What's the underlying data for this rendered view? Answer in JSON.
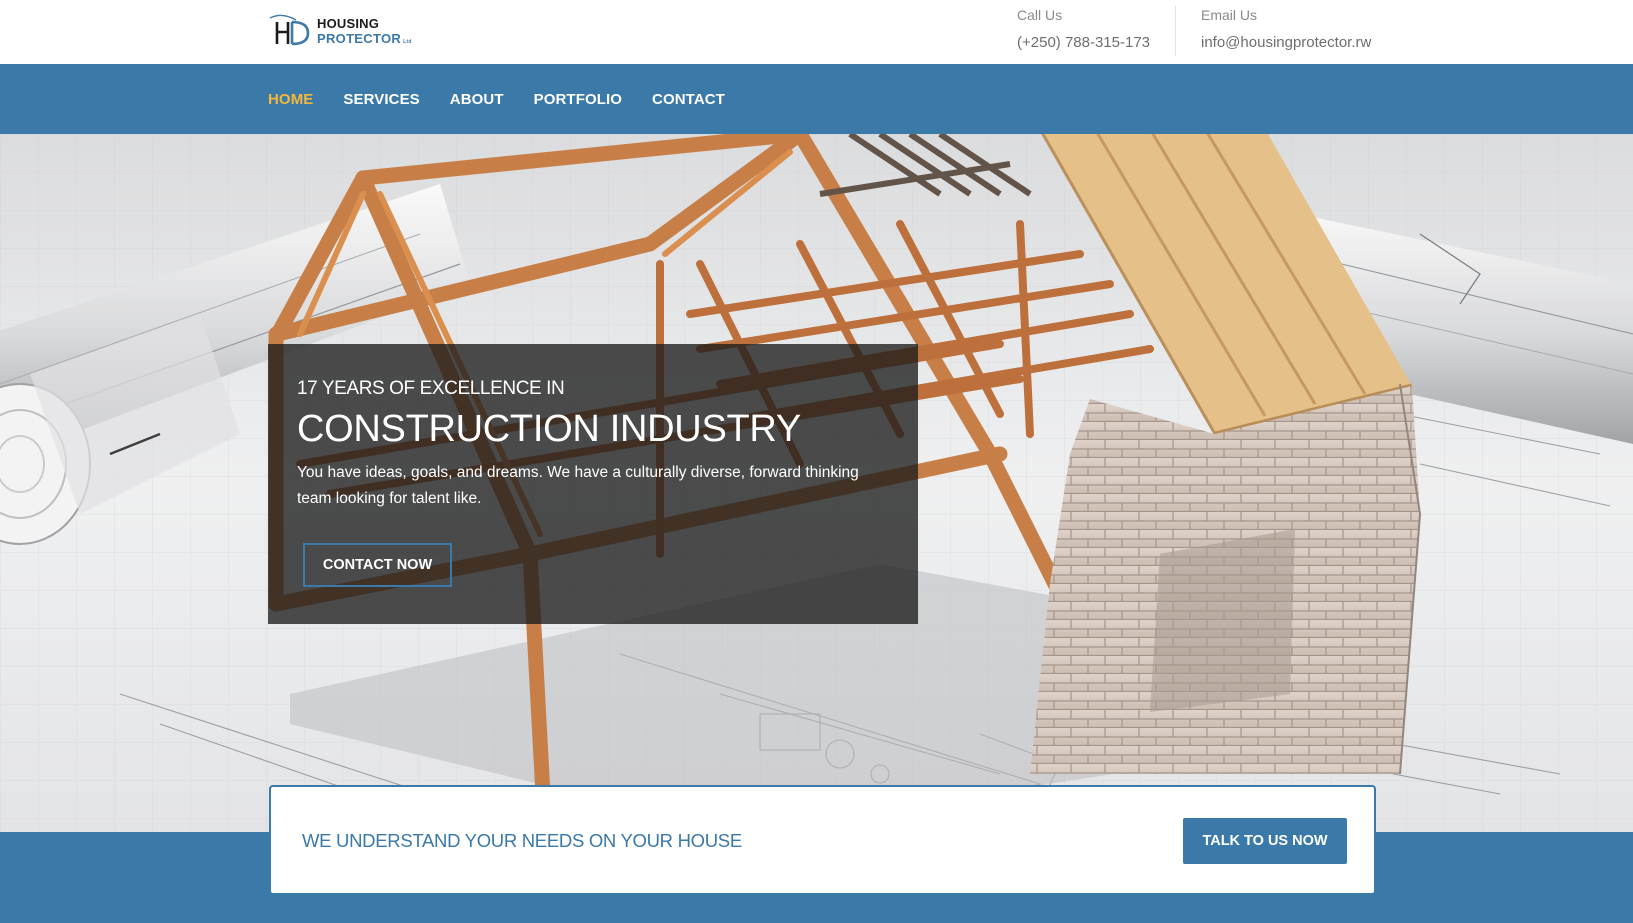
{
  "header": {
    "logo": {
      "line1": "HOUSING",
      "line2": "PROTECTOR",
      "suffix": "Ltd",
      "mark": "HP"
    },
    "call": {
      "label": "Call Us",
      "value": "(+250) 788-315-173"
    },
    "email": {
      "label": "Email Us",
      "value": "info@housingprotector.rw"
    }
  },
  "nav": {
    "items": [
      {
        "label": "HOME",
        "active": true
      },
      {
        "label": "SERVICES",
        "active": false
      },
      {
        "label": "ABOUT",
        "active": false
      },
      {
        "label": "PORTFOLIO",
        "active": false
      },
      {
        "label": "CONTACT",
        "active": false
      }
    ]
  },
  "hero": {
    "kicker": "17 YEARS OF EXCELLENCE IN",
    "title": "CONSTRUCTION INDUSTRY",
    "description": "You have ideas, goals, and dreams. We have a culturally diverse, forward thinking team looking for talent like.",
    "cta_label": "CONTACT NOW",
    "image_icon": "house-frame-on-blueprints-image"
  },
  "cta_bar": {
    "text": "WE UNDERSTAND YOUR NEEDS ON YOUR HOUSE",
    "button_label": "TALK TO US NOW"
  },
  "colors": {
    "brand_blue": "#3a79a8",
    "active_nav": "#f3b83c",
    "panel_overlay": "rgba(28,28,28,0.78)",
    "white": "#ffffff"
  }
}
